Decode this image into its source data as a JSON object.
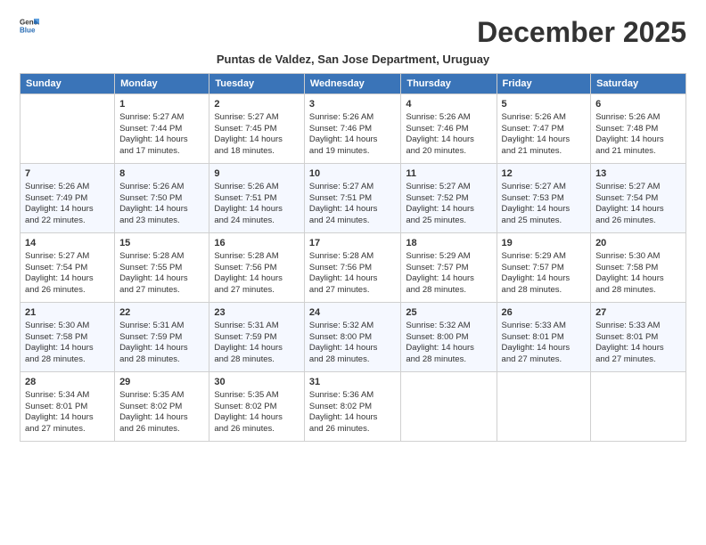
{
  "logo": {
    "general": "General",
    "blue": "Blue"
  },
  "title": "December 2025",
  "subtitle": "Puntas de Valdez, San Jose Department, Uruguay",
  "days_of_week": [
    "Sunday",
    "Monday",
    "Tuesday",
    "Wednesday",
    "Thursday",
    "Friday",
    "Saturday"
  ],
  "weeks": [
    [
      {
        "day": "",
        "content": ""
      },
      {
        "day": "1",
        "content": "Sunrise: 5:27 AM\nSunset: 7:44 PM\nDaylight: 14 hours\nand 17 minutes."
      },
      {
        "day": "2",
        "content": "Sunrise: 5:27 AM\nSunset: 7:45 PM\nDaylight: 14 hours\nand 18 minutes."
      },
      {
        "day": "3",
        "content": "Sunrise: 5:26 AM\nSunset: 7:46 PM\nDaylight: 14 hours\nand 19 minutes."
      },
      {
        "day": "4",
        "content": "Sunrise: 5:26 AM\nSunset: 7:46 PM\nDaylight: 14 hours\nand 20 minutes."
      },
      {
        "day": "5",
        "content": "Sunrise: 5:26 AM\nSunset: 7:47 PM\nDaylight: 14 hours\nand 21 minutes."
      },
      {
        "day": "6",
        "content": "Sunrise: 5:26 AM\nSunset: 7:48 PM\nDaylight: 14 hours\nand 21 minutes."
      }
    ],
    [
      {
        "day": "7",
        "content": "Sunrise: 5:26 AM\nSunset: 7:49 PM\nDaylight: 14 hours\nand 22 minutes."
      },
      {
        "day": "8",
        "content": "Sunrise: 5:26 AM\nSunset: 7:50 PM\nDaylight: 14 hours\nand 23 minutes."
      },
      {
        "day": "9",
        "content": "Sunrise: 5:26 AM\nSunset: 7:51 PM\nDaylight: 14 hours\nand 24 minutes."
      },
      {
        "day": "10",
        "content": "Sunrise: 5:27 AM\nSunset: 7:51 PM\nDaylight: 14 hours\nand 24 minutes."
      },
      {
        "day": "11",
        "content": "Sunrise: 5:27 AM\nSunset: 7:52 PM\nDaylight: 14 hours\nand 25 minutes."
      },
      {
        "day": "12",
        "content": "Sunrise: 5:27 AM\nSunset: 7:53 PM\nDaylight: 14 hours\nand 25 minutes."
      },
      {
        "day": "13",
        "content": "Sunrise: 5:27 AM\nSunset: 7:54 PM\nDaylight: 14 hours\nand 26 minutes."
      }
    ],
    [
      {
        "day": "14",
        "content": "Sunrise: 5:27 AM\nSunset: 7:54 PM\nDaylight: 14 hours\nand 26 minutes."
      },
      {
        "day": "15",
        "content": "Sunrise: 5:28 AM\nSunset: 7:55 PM\nDaylight: 14 hours\nand 27 minutes."
      },
      {
        "day": "16",
        "content": "Sunrise: 5:28 AM\nSunset: 7:56 PM\nDaylight: 14 hours\nand 27 minutes."
      },
      {
        "day": "17",
        "content": "Sunrise: 5:28 AM\nSunset: 7:56 PM\nDaylight: 14 hours\nand 27 minutes."
      },
      {
        "day": "18",
        "content": "Sunrise: 5:29 AM\nSunset: 7:57 PM\nDaylight: 14 hours\nand 28 minutes."
      },
      {
        "day": "19",
        "content": "Sunrise: 5:29 AM\nSunset: 7:57 PM\nDaylight: 14 hours\nand 28 minutes."
      },
      {
        "day": "20",
        "content": "Sunrise: 5:30 AM\nSunset: 7:58 PM\nDaylight: 14 hours\nand 28 minutes."
      }
    ],
    [
      {
        "day": "21",
        "content": "Sunrise: 5:30 AM\nSunset: 7:58 PM\nDaylight: 14 hours\nand 28 minutes."
      },
      {
        "day": "22",
        "content": "Sunrise: 5:31 AM\nSunset: 7:59 PM\nDaylight: 14 hours\nand 28 minutes."
      },
      {
        "day": "23",
        "content": "Sunrise: 5:31 AM\nSunset: 7:59 PM\nDaylight: 14 hours\nand 28 minutes."
      },
      {
        "day": "24",
        "content": "Sunrise: 5:32 AM\nSunset: 8:00 PM\nDaylight: 14 hours\nand 28 minutes."
      },
      {
        "day": "25",
        "content": "Sunrise: 5:32 AM\nSunset: 8:00 PM\nDaylight: 14 hours\nand 28 minutes."
      },
      {
        "day": "26",
        "content": "Sunrise: 5:33 AM\nSunset: 8:01 PM\nDaylight: 14 hours\nand 27 minutes."
      },
      {
        "day": "27",
        "content": "Sunrise: 5:33 AM\nSunset: 8:01 PM\nDaylight: 14 hours\nand 27 minutes."
      }
    ],
    [
      {
        "day": "28",
        "content": "Sunrise: 5:34 AM\nSunset: 8:01 PM\nDaylight: 14 hours\nand 27 minutes."
      },
      {
        "day": "29",
        "content": "Sunrise: 5:35 AM\nSunset: 8:02 PM\nDaylight: 14 hours\nand 26 minutes."
      },
      {
        "day": "30",
        "content": "Sunrise: 5:35 AM\nSunset: 8:02 PM\nDaylight: 14 hours\nand 26 minutes."
      },
      {
        "day": "31",
        "content": "Sunrise: 5:36 AM\nSunset: 8:02 PM\nDaylight: 14 hours\nand 26 minutes."
      },
      {
        "day": "",
        "content": ""
      },
      {
        "day": "",
        "content": ""
      },
      {
        "day": "",
        "content": ""
      }
    ]
  ]
}
